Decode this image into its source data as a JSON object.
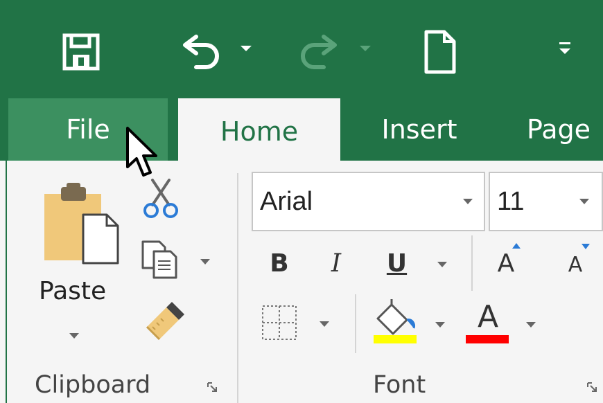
{
  "tabs": {
    "file": "File",
    "home": "Home",
    "insert": "Insert",
    "page": "Page"
  },
  "ribbon": {
    "clipboard": {
      "paste_label": "Paste",
      "group_label": "Clipboard"
    },
    "font": {
      "font_name": "Arial",
      "font_size": "11",
      "bold": "B",
      "italic": "I",
      "underline": "U",
      "grow_glyph": "A",
      "shrink_glyph": "A",
      "font_color_glyph": "A",
      "group_label": "Font"
    }
  },
  "icons": {
    "save": "save-icon",
    "undo": "undo-icon",
    "redo": "redo-icon",
    "new_doc": "new-document-icon",
    "customize": "customize-qat-icon",
    "paste": "clipboard-icon",
    "cut": "scissors-icon",
    "copy": "copy-icon",
    "format_painter": "paintbrush-icon",
    "borders": "borders-icon",
    "fill": "paint-bucket-icon",
    "cursor": "mouse-pointer-icon"
  },
  "colors": {
    "accent": "#217346",
    "file_tab": "#3c9060",
    "ribbon_bg": "#f5f5f5",
    "highlight": "#ffff00",
    "font_color": "#ff0000"
  }
}
